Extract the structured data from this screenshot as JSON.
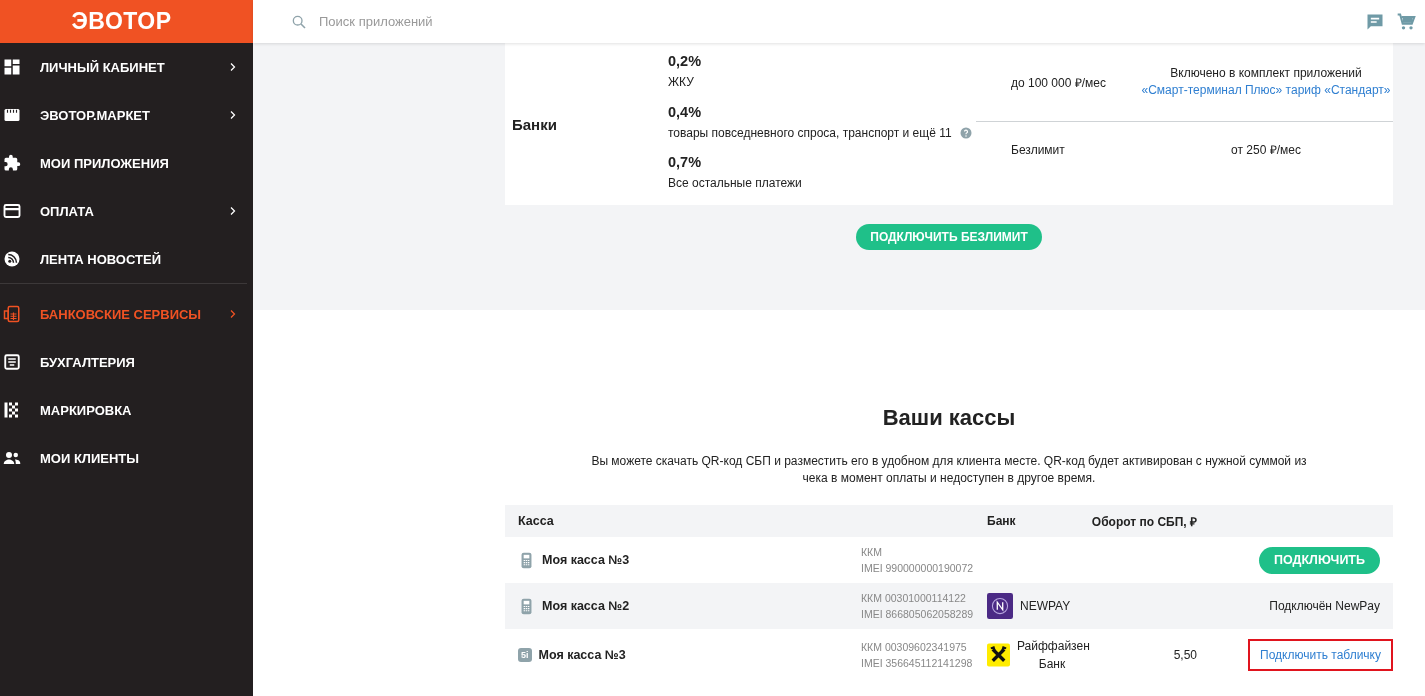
{
  "logo": "ЭВОТОР",
  "search": {
    "placeholder": "Поиск приложений"
  },
  "sidebar": {
    "items": [
      {
        "label": "ЛИЧНЫЙ КАБИНЕТ",
        "has_submenu": true,
        "selected": false,
        "divider_after": false
      },
      {
        "label": "ЭВОТОР.МАРКЕТ",
        "has_submenu": true,
        "selected": false,
        "divider_after": false
      },
      {
        "label": "МОИ ПРИЛОЖЕНИЯ",
        "has_submenu": false,
        "selected": false,
        "divider_after": false
      },
      {
        "label": "ОПЛАТА",
        "has_submenu": true,
        "selected": false,
        "divider_after": false
      },
      {
        "label": "ЛЕНТА НОВОСТЕЙ",
        "has_submenu": false,
        "selected": false,
        "divider_after": true
      },
      {
        "label": "БАНКОВСКИЕ СЕРВИСЫ",
        "has_submenu": true,
        "selected": true,
        "divider_after": false
      },
      {
        "label": "БУХГАЛТЕРИЯ",
        "has_submenu": false,
        "selected": false,
        "divider_after": false
      },
      {
        "label": "МАРКИРОВКА",
        "has_submenu": false,
        "selected": false,
        "divider_after": false
      },
      {
        "label": "МОИ КЛИЕНТЫ",
        "has_submenu": false,
        "selected": false,
        "divider_after": false
      }
    ]
  },
  "tariff": {
    "provider": "Банки",
    "rates": [
      {
        "rate": "0,2%",
        "description": "ЖКУ",
        "help": false
      },
      {
        "rate": "0,4%",
        "description": "товары повседневного спроса, транспорт и ещё 11",
        "help": true
      },
      {
        "rate": "0,7%",
        "description": "Все остальные платежи",
        "help": false
      }
    ],
    "plans": [
      {
        "limit": "до 100 000 ₽/мес",
        "price": "Включено в комплект приложений",
        "price_link": "«Смарт-терминал Плюс» тариф «Стандарт»"
      },
      {
        "limit": "Безлимит",
        "price": "от 250 ₽/мес"
      }
    ],
    "button": "ПОДКЛЮЧИТЬ БЕЗЛИМИТ"
  },
  "registers": {
    "title": "Ваши кассы",
    "description": "Вы можете скачать QR-код СБП и разместить его в удобном для клиента месте. QR-код будет активирован с нужной суммой из чека в момент оплаты и недоступен в другое время.",
    "columns": [
      "Касса",
      "Банк",
      "Оборот по СБП, ₽"
    ],
    "rows": [
      {
        "name": "Моя касса №3",
        "kkm": "ККМ",
        "imei": "IMEI 990000000190072",
        "action": {
          "kind": "button",
          "label": "ПОДКЛЮЧИТЬ",
          "highlighted": false
        }
      },
      {
        "name": "Моя касса №2",
        "kkm": "ККМ 00301000114122",
        "imei": "IMEI 866805062058289",
        "bank": {
          "name": "NEWPAY"
        },
        "action": {
          "kind": "text",
          "label": "Подключён NewPay",
          "highlighted": false
        }
      },
      {
        "badge": "5i",
        "name": "Моя касса №3",
        "kkm": "ККМ 00309602341975",
        "imei": "IMEI 356645112141298",
        "bank": {
          "name": "Райффайзен Банк"
        },
        "turnover": "5,50",
        "action": {
          "kind": "link",
          "label": "Подключить табличку",
          "highlighted": true
        }
      }
    ]
  }
}
